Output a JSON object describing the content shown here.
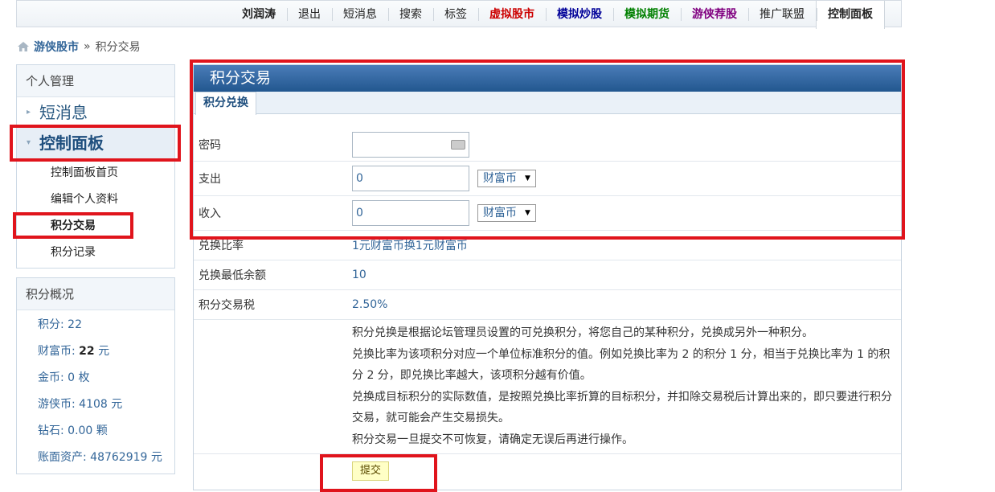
{
  "topnav": [
    {
      "label": "刘润涛",
      "color": "#222222",
      "bold": true
    },
    {
      "label": "退出",
      "color": "#222222",
      "bold": false
    },
    {
      "label": "短消息",
      "color": "#222222",
      "bold": false
    },
    {
      "label": "搜索",
      "color": "#222222",
      "bold": false
    },
    {
      "label": "标签",
      "color": "#222222",
      "bold": false
    },
    {
      "label": "虚拟股市",
      "color": "#cc0000",
      "bold": true
    },
    {
      "label": "模拟炒股",
      "color": "#000099",
      "bold": true
    },
    {
      "label": "模拟期货",
      "color": "#008000",
      "bold": true
    },
    {
      "label": "游侠荐股",
      "color": "#800080",
      "bold": true
    },
    {
      "label": "推广联盟",
      "color": "#222222",
      "bold": false
    },
    {
      "label": "控制面板",
      "color": "#222222",
      "bold": true,
      "active": true
    }
  ],
  "breadcrumb": {
    "site": "游侠股市",
    "sep": "»",
    "current": "积分交易"
  },
  "sidebar": {
    "header": "个人管理",
    "items": [
      {
        "label": "短消息"
      },
      {
        "label": "控制面板"
      }
    ],
    "subitems": [
      "控制面板首页",
      "编辑个人资料",
      "积分交易",
      "积分记录"
    ]
  },
  "overview": {
    "header": "积分概况",
    "lines": [
      {
        "label": "积分: ",
        "value": "22",
        "tail": ""
      },
      {
        "label": "财富币: ",
        "value": "22",
        "tail": " 元"
      },
      {
        "label": "金币: ",
        "value": "0",
        "tail": " 枚"
      },
      {
        "label": "游侠币: ",
        "value": "4108",
        "tail": " 元"
      },
      {
        "label": "钻石: ",
        "value": "0.00",
        "tail": " 颗"
      },
      {
        "label": "账面资产: ",
        "value": "48762919",
        "tail": " 元"
      }
    ]
  },
  "panel": {
    "title": "积分交易",
    "tab": "积分兑换",
    "password_label": "密码",
    "out_label": "支出",
    "out_value": "0",
    "out_currency": "财富币",
    "in_label": "收入",
    "in_value": "0",
    "in_currency": "财富币",
    "ratio_label": "兑换比率",
    "ratio_value": "1元财富币换1元财富币",
    "min_label": "兑换最低余额",
    "min_value": "10",
    "tax_label": "积分交易税",
    "tax_value": "2.50%",
    "desc": [
      "积分兑换是根据论坛管理员设置的可兑换积分，将您自己的某种积分，兑换成另外一种积分。",
      "兑换比率为该项积分对应一个单位标准积分的值。例如兑换比率为 2 的积分 1 分，相当于兑换比率为 1 的积分 2 分，即兑换比率越大，该项积分越有价值。",
      "兑换成目标积分的实际数值，是按照兑换比率折算的目标积分，并扣除交易税后计算出来的，即只要进行积分交易，就可能会产生交易损失。",
      "积分交易一旦提交不可恢复，请确定无误后再进行操作。"
    ],
    "submit": "提交"
  },
  "colors": {
    "accent": "#22578f",
    "highlight": "#e0141c",
    "link": "#336699"
  }
}
